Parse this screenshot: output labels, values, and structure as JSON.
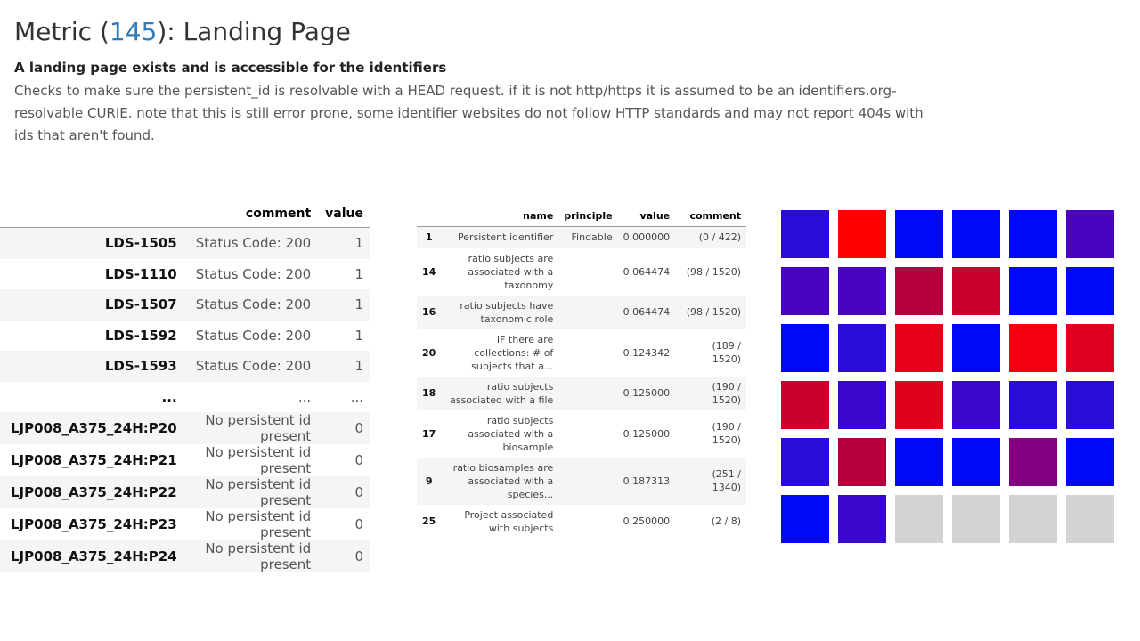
{
  "header": {
    "title_prefix": "Metric (",
    "metric_id": "145",
    "title_suffix": "): Landing Page",
    "subtitle": "A landing page exists and is accessible for the identifiers",
    "description": "Checks to make sure the persistent_id is resolvable with a HEAD request. if it is not http/https it is assumed to be an identifiers.org-resolvable CURIE. note that this is still error prone, some identifier websites do not follow HTTP standards and may not report 404s with ids that aren't found."
  },
  "results_table": {
    "columns": [
      "",
      "comment",
      "value"
    ],
    "rows": [
      {
        "id": "LDS-1505",
        "comment": "Status Code: 200",
        "value": "1"
      },
      {
        "id": "LDS-1110",
        "comment": "Status Code: 200",
        "value": "1"
      },
      {
        "id": "LDS-1507",
        "comment": "Status Code: 200",
        "value": "1"
      },
      {
        "id": "LDS-1592",
        "comment": "Status Code: 200",
        "value": "1"
      },
      {
        "id": "LDS-1593",
        "comment": "Status Code: 200",
        "value": "1"
      },
      {
        "id": "...",
        "comment": "...",
        "value": "..."
      },
      {
        "id": "LJP008_A375_24H:P20",
        "comment": "No persistent id present",
        "value": "0"
      },
      {
        "id": "LJP008_A375_24H:P21",
        "comment": "No persistent id present",
        "value": "0"
      },
      {
        "id": "LJP008_A375_24H:P22",
        "comment": "No persistent id present",
        "value": "0"
      },
      {
        "id": "LJP008_A375_24H:P23",
        "comment": "No persistent id present",
        "value": "0"
      },
      {
        "id": "LJP008_A375_24H:P24",
        "comment": "No persistent id present",
        "value": "0"
      }
    ]
  },
  "metrics_table": {
    "columns": [
      "",
      "name",
      "principle",
      "value",
      "comment"
    ],
    "rows": [
      {
        "idx": "1",
        "name": "Persistent identifier",
        "principle": "Findable",
        "value": "0.000000",
        "comment": "(0 / 422)"
      },
      {
        "idx": "14",
        "name": "ratio subjects are associated with a taxonomy",
        "principle": "",
        "value": "0.064474",
        "comment": "(98 / 1520)"
      },
      {
        "idx": "16",
        "name": "ratio subjects have taxonomic role",
        "principle": "",
        "value": "0.064474",
        "comment": "(98 / 1520)"
      },
      {
        "idx": "20",
        "name": "IF there are collections: # of subjects that a...",
        "principle": "",
        "value": "0.124342",
        "comment": "(189 / 1520)"
      },
      {
        "idx": "18",
        "name": "ratio subjects associated with a file",
        "principle": "",
        "value": "0.125000",
        "comment": "(190 / 1520)"
      },
      {
        "idx": "17",
        "name": "ratio subjects associated with a biosample",
        "principle": "",
        "value": "0.125000",
        "comment": "(190 / 1520)"
      },
      {
        "idx": "9",
        "name": "ratio biosamples are associated with a species...",
        "principle": "",
        "value": "0.187313",
        "comment": "(251 / 1340)"
      },
      {
        "idx": "25",
        "name": "Project associated with subjects",
        "principle": "",
        "value": "0.250000",
        "comment": "(2 / 8)"
      }
    ]
  },
  "heatmap": {
    "colors": [
      "#2a0cd8",
      "#ff0000",
      "#0008f5",
      "#0008f5",
      "#0008f5",
      "#4a04c0",
      "#4a04c0",
      "#4a04c0",
      "#b5003e",
      "#cc002e",
      "#0008f5",
      "#0008f5",
      "#0008f5",
      "#2a0cd8",
      "#e8001a",
      "#0008f5",
      "#f20010",
      "#dd0020",
      "#cc002e",
      "#3a07cc",
      "#e0001c",
      "#3a07cc",
      "#2a0cd8",
      "#2a0cd8",
      "#2a0cd8",
      "#b5003e",
      "#0008f5",
      "#0008f5",
      "#830080",
      "#0008f5",
      "#0008f5",
      "#3a07cc",
      "#d3d3d3",
      "#d3d3d3",
      "#d3d3d3",
      "#d3d3d3"
    ]
  }
}
